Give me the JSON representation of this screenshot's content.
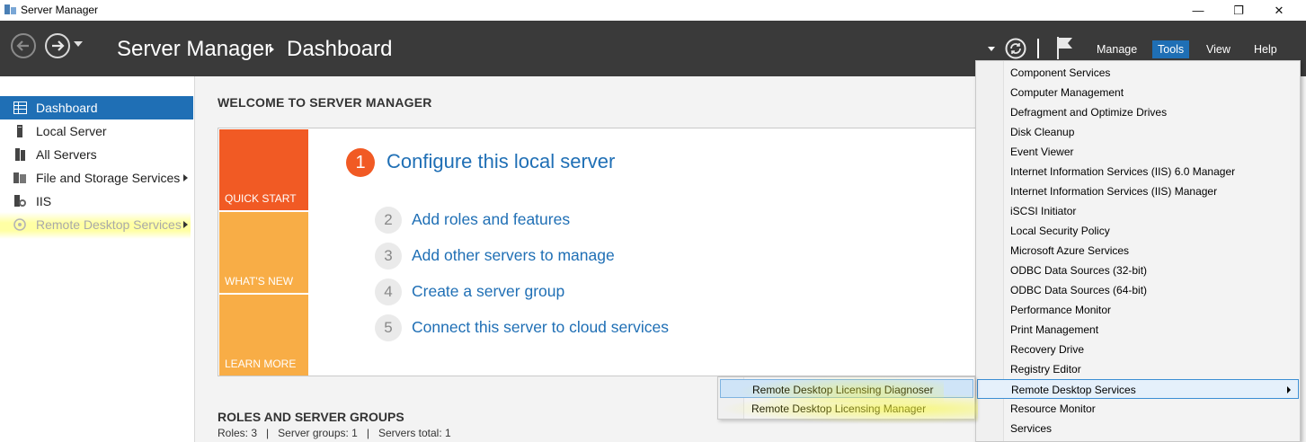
{
  "window": {
    "title": "Server Manager",
    "minimize_glyph": "—",
    "maximize_glyph": "❐",
    "close_glyph": "✕"
  },
  "header": {
    "breadcrumb": [
      "Server Manager",
      "Dashboard"
    ],
    "menu": [
      "Manage",
      "Tools",
      "View",
      "Help"
    ]
  },
  "sidebar": {
    "items": [
      {
        "label": "Dashboard",
        "icon": "dashboard-icon"
      },
      {
        "label": "Local Server",
        "icon": "server-icon"
      },
      {
        "label": "All Servers",
        "icon": "servers-icon"
      },
      {
        "label": "File and Storage Services",
        "icon": "storage-icon"
      },
      {
        "label": "IIS",
        "icon": "iis-icon"
      },
      {
        "label": "Remote Desktop Services",
        "icon": "remote-desktop-icon"
      }
    ]
  },
  "main": {
    "welcome_title": "WELCOME TO SERVER MANAGER",
    "tiles": [
      "QUICK START",
      "WHAT'S NEW",
      "LEARN MORE"
    ],
    "step1": {
      "number": "1",
      "text": "Configure this local server"
    },
    "steps": [
      {
        "number": "2",
        "text": "Add roles and features"
      },
      {
        "number": "3",
        "text": "Add other servers to manage"
      },
      {
        "number": "4",
        "text": "Create a server group"
      },
      {
        "number": "5",
        "text": "Connect this server to cloud services"
      }
    ],
    "roles_title": "ROLES AND SERVER GROUPS",
    "roles_summary": "Roles: 3   |   Server groups: 1   |   Servers total: 1"
  },
  "tools_menu": [
    "Component Services",
    "Computer Management",
    "Defragment and Optimize Drives",
    "Disk Cleanup",
    "Event Viewer",
    "Internet Information Services (IIS) 6.0 Manager",
    "Internet Information Services (IIS) Manager",
    "iSCSI Initiator",
    "Local Security Policy",
    "Microsoft Azure Services",
    "ODBC Data Sources (32-bit)",
    "ODBC Data Sources (64-bit)",
    "Performance Monitor",
    "Print Management",
    "Recovery Drive",
    "Registry Editor",
    "Remote Desktop Services",
    "Resource Monitor",
    "Services"
  ],
  "submenu": [
    "Remote Desktop Licensing Diagnoser",
    "Remote Desktop Licensing Manager"
  ],
  "colors": {
    "accent": "#1f6fb5",
    "header": "#3a3a3a",
    "orange": "#f15a24",
    "light_orange": "#f8ad46"
  }
}
